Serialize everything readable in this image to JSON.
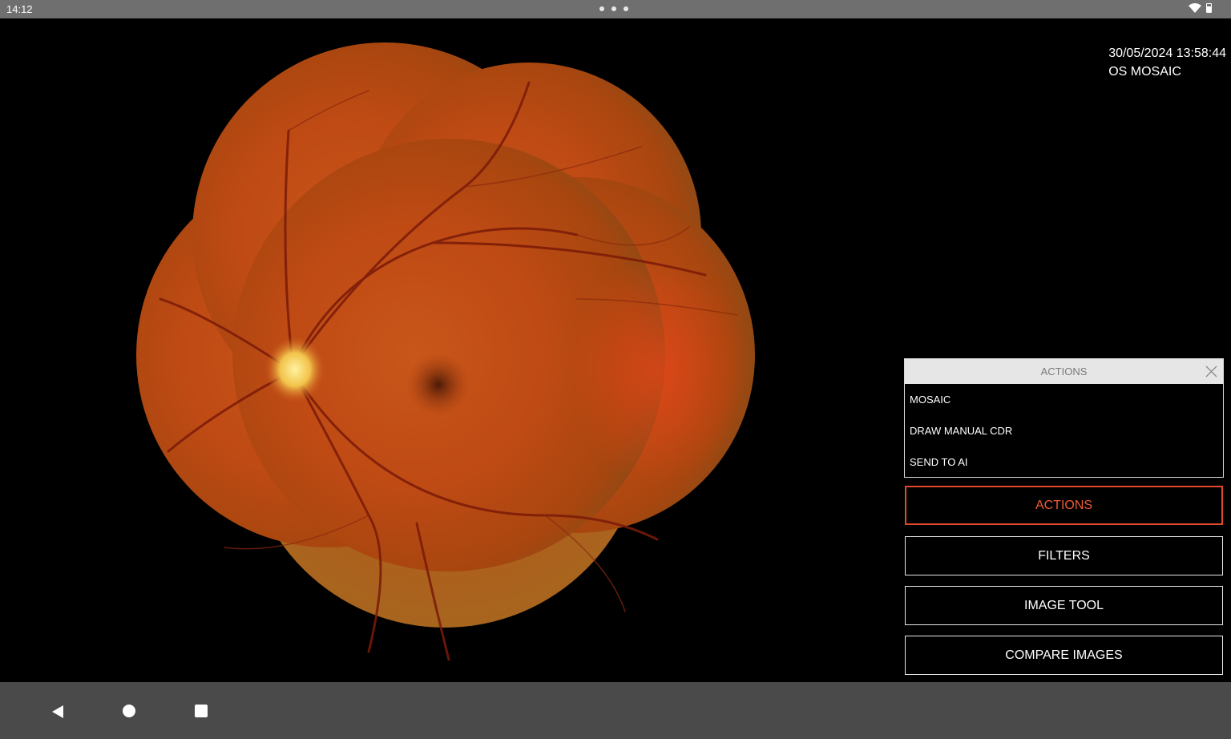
{
  "status_bar": {
    "time": "14:12"
  },
  "image_info": {
    "datetime": "30/05/2024 13:58:44",
    "label": "OS MOSAIC"
  },
  "actions_panel": {
    "title": "ACTIONS",
    "items": [
      {
        "label": "MOSAIC"
      },
      {
        "label": "DRAW MANUAL CDR"
      },
      {
        "label": "SEND TO AI"
      }
    ]
  },
  "buttons": [
    {
      "label": "ACTIONS",
      "active": true
    },
    {
      "label": "FILTERS",
      "active": false
    },
    {
      "label": "IMAGE TOOL",
      "active": false
    },
    {
      "label": "COMPARE IMAGES",
      "active": false
    }
  ],
  "colors": {
    "accent": "#f05a34",
    "status_bar": "#6f6f6f",
    "nav_bar": "#4a4a4a",
    "panel_header": "#e6e6e6"
  },
  "icons": {
    "close": "close-icon",
    "wifi": "wifi-icon",
    "battery": "battery-icon",
    "back": "back-triangle-icon",
    "home": "home-circle-icon",
    "recents": "recents-square-icon"
  }
}
